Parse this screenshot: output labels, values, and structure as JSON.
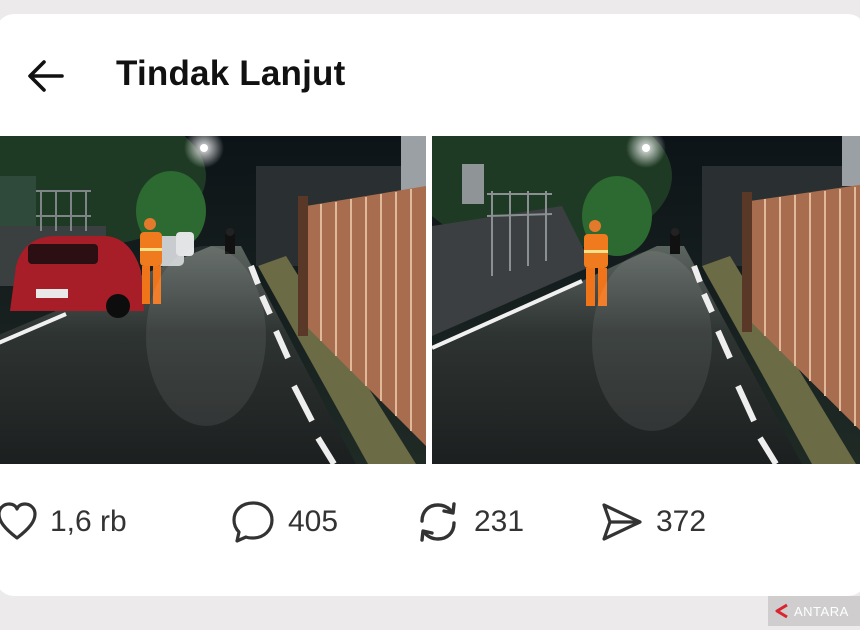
{
  "header": {
    "title": "Tindak Lanjut",
    "back_icon": "arrow-left-icon"
  },
  "photos": [
    {
      "description": "left-photo"
    },
    {
      "description": "right-photo"
    }
  ],
  "actions": {
    "likes": {
      "icon": "heart-icon",
      "count": "1,6 rb"
    },
    "comments": {
      "icon": "comment-bubble-icon",
      "count": "405"
    },
    "reposts": {
      "icon": "repost-icon",
      "count": "231"
    },
    "shares": {
      "icon": "send-icon",
      "count": "372"
    }
  },
  "watermark": {
    "text": "ANTARA"
  },
  "colors": {
    "card": "#ffffff",
    "page": "#eceaeb",
    "text": "#111111",
    "icon": "#333333",
    "worker_uniform": "#f07a1e",
    "car": "#b5262f",
    "fence": "#b07a5a"
  }
}
